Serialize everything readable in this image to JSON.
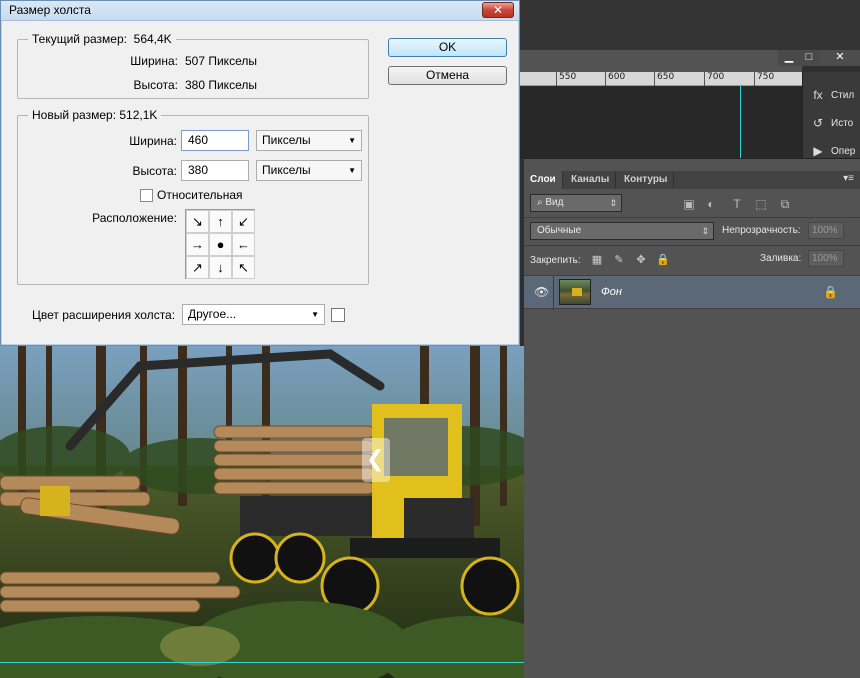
{
  "dialog": {
    "title": "Размер холста",
    "close_label": "✕",
    "current": {
      "group_title": "Текущий размер:",
      "size": "564,4K",
      "width_label": "Ширина:",
      "width_value": "507 Пикселы",
      "height_label": "Высота:",
      "height_value": "380 Пикселы"
    },
    "new": {
      "group_title": "Новый размер:",
      "size": "512,1K",
      "width_label": "Ширина:",
      "width_value": "460",
      "width_unit": "Пикселы",
      "height_label": "Высота:",
      "height_value": "380",
      "height_unit": "Пикселы",
      "relative_label": "Относительная",
      "anchor_label": "Расположение:"
    },
    "extension": {
      "label": "Цвет расширения холста:",
      "value": "Другое..."
    },
    "ok_label": "OK",
    "cancel_label": "Отмена",
    "anchor_arrows": [
      "↘",
      "↑",
      "↙",
      "→",
      "●",
      "←",
      "↗",
      "↓",
      "↖"
    ]
  },
  "ruler": {
    "labels": [
      "550",
      "600",
      "650",
      "700",
      "750"
    ]
  },
  "window_controls": {
    "minimize": "▁",
    "maximize": "□",
    "close": "✕"
  },
  "side_panel": {
    "items": [
      {
        "icon": "fx",
        "label": "Стил"
      },
      {
        "icon": "↺",
        "label": "Исто"
      },
      {
        "icon": "▶",
        "label": "Опер"
      }
    ]
  },
  "layers_panel": {
    "tabs": [
      "Слои",
      "Каналы",
      "Контуры"
    ],
    "menu_icon": "▾≡",
    "filter_label": "⌕ Вид",
    "filter_icons": [
      "▣",
      "◐",
      "T",
      "⬚",
      "⧉"
    ],
    "blend_mode": "Обычные",
    "opacity_label": "Непрозрачность:",
    "opacity_value": "100%",
    "lock_label": "Закрепить:",
    "lock_icons": [
      "▦",
      "✎",
      "✥",
      "🔒"
    ],
    "fill_label": "Заливка:",
    "fill_value": "100%",
    "layer": {
      "name": "Фон",
      "eye": "👁",
      "lock": "🔒"
    }
  },
  "canvas": {
    "nav_arrow": "❮"
  }
}
